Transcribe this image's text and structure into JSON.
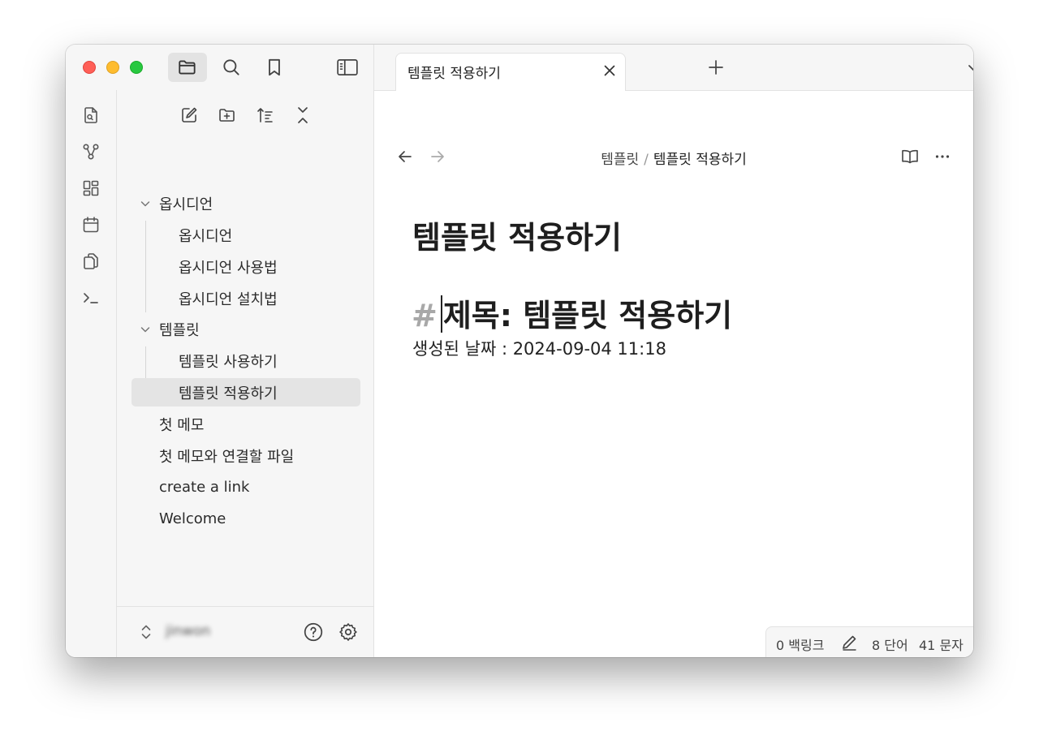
{
  "window": {
    "traffic_lights": {
      "close": "#ff5f57",
      "minimize": "#febc2e",
      "zoom": "#28c840"
    }
  },
  "left_toolbar": {
    "buttons": [
      {
        "icon": "folder-icon",
        "active": true
      },
      {
        "icon": "search-icon",
        "active": false
      },
      {
        "icon": "bookmark-icon",
        "active": false
      }
    ],
    "sidebar_toggle_icon": "sidebar-left-icon"
  },
  "ribbon": {
    "icons": [
      "file-search-icon",
      "graph-icon",
      "canvas-icon",
      "calendar-icon",
      "copy-icon",
      "terminal-icon"
    ]
  },
  "sidebar": {
    "toolbar": [
      "new-note-icon",
      "new-folder-icon",
      "sort-icon",
      "collapse-all-icon"
    ],
    "tree": [
      {
        "label": "옵시디언",
        "type": "folder",
        "expanded": true,
        "children": [
          {
            "label": "옵시디언"
          },
          {
            "label": "옵시디언 사용법"
          },
          {
            "label": "옵시디언 설치법"
          }
        ]
      },
      {
        "label": "템플릿",
        "type": "folder",
        "expanded": true,
        "children": [
          {
            "label": "템플릿 사용하기"
          },
          {
            "label": "템플릿 적용하기",
            "selected": true
          }
        ]
      },
      {
        "label": "첫 메모"
      },
      {
        "label": "첫 메모와 연결할 파일"
      },
      {
        "label": "create a link"
      },
      {
        "label": "Welcome"
      }
    ],
    "footer": {
      "vault_name": "jinwon",
      "help_icon": "help-icon",
      "settings_icon": "gear-icon"
    }
  },
  "tabs": [
    {
      "title": "템플릿 적용하기",
      "active": true
    }
  ],
  "editor": {
    "breadcrumb": {
      "folder": "템플릿",
      "separator": "/",
      "file": "템플릿 적용하기"
    },
    "title": "템플릿 적용하기",
    "heading_hash": "#",
    "heading": "제목: 템플릿 적용하기",
    "body_line": "생성된 날짜 : 2024-09-04 11:18"
  },
  "status_bar": {
    "backlinks": "0 백링크",
    "words": "8 단어",
    "chars": "41 문자"
  }
}
